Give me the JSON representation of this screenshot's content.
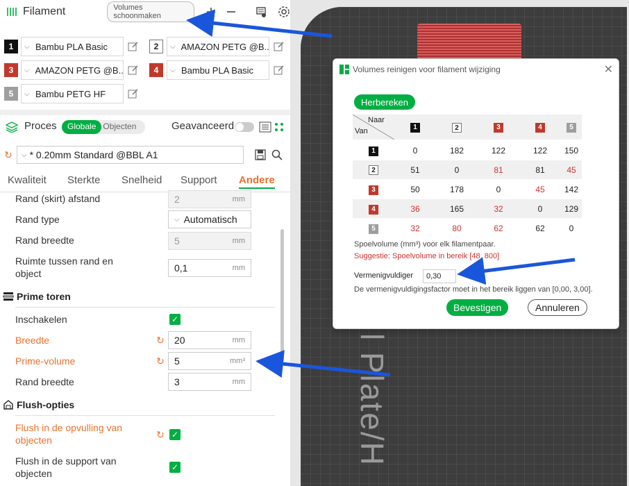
{
  "filament": {
    "title": "Filament",
    "clean_button": "Volumes schoonmaken",
    "slots": [
      {
        "num": "1",
        "name": "Bambu PLA Basic",
        "color": "#111111",
        "text_color": "#ffffff"
      },
      {
        "num": "2",
        "name": "AMAZON PETG @B...",
        "color": "#ffffff",
        "text_color": "#222222"
      },
      {
        "num": "3",
        "name": "AMAZON PETG @B...",
        "color": "#c0392b",
        "text_color": "#ffffff"
      },
      {
        "num": "4",
        "name": "Bambu PLA Basic",
        "color": "#c0392b",
        "text_color": "#ffffff"
      },
      {
        "num": "5",
        "name": "Bambu PETG HF",
        "color": "#9e9e9e",
        "text_color": "#ffffff"
      }
    ]
  },
  "process": {
    "title": "Proces",
    "seg_global": "Globale",
    "seg_objects": "Objecten",
    "advanced": "Geavanceerd",
    "preset": "* 0.20mm Standard @BBL A1"
  },
  "tabs": [
    "Kwaliteit",
    "Sterkte",
    "Snelheid",
    "Support",
    "Andere"
  ],
  "settings": {
    "skirt_distance": {
      "label": "Rand (skirt) afstand",
      "value": "2",
      "unit": "mm"
    },
    "skirt_type": {
      "label": "Rand type",
      "value": "Automatisch"
    },
    "skirt_width": {
      "label": "Rand breedte",
      "value": "5",
      "unit": "mm"
    },
    "skirt_gap": {
      "label_1": "Ruimte tussen rand en",
      "label_2": "object",
      "value": "0,1",
      "unit": "mm"
    }
  },
  "prime": {
    "title": "Prime toren",
    "enable": "Inschakelen",
    "width": {
      "label": "Breedte",
      "value": "20",
      "unit": "mm"
    },
    "volume": {
      "label": "Prime-volume",
      "value": "5",
      "unit": "mm³"
    },
    "brim": {
      "label": "Rand breedte",
      "value": "3",
      "unit": "mm"
    }
  },
  "flush": {
    "title": "Flush-opties",
    "infill_1": "Flush in de opvulling van",
    "infill_2": "objecten",
    "support_1": "Flush in de support van",
    "support_2": "objecten"
  },
  "canvas": {
    "plate_text": "l Plate/H"
  },
  "dialog": {
    "title": "Volumes reinigen voor filament wijziging",
    "recalc": "Herbereken",
    "naar": "Naar",
    "van": "Van",
    "header_chips": [
      "1",
      "2",
      "3",
      "4",
      "5"
    ],
    "rows": [
      {
        "chip": "1",
        "vals": [
          "0",
          "182",
          "122",
          "122",
          "150"
        ],
        "red": [
          false,
          false,
          false,
          false,
          false
        ]
      },
      {
        "chip": "2",
        "vals": [
          "51",
          "0",
          "81",
          "81",
          "45"
        ],
        "red": [
          false,
          false,
          true,
          false,
          true
        ]
      },
      {
        "chip": "3",
        "vals": [
          "50",
          "178",
          "0",
          "45",
          "142"
        ],
        "red": [
          false,
          false,
          false,
          true,
          false
        ]
      },
      {
        "chip": "4",
        "vals": [
          "36",
          "165",
          "32",
          "0",
          "129"
        ],
        "red": [
          true,
          false,
          true,
          false,
          false
        ]
      },
      {
        "chip": "5",
        "vals": [
          "32",
          "80",
          "62",
          "62",
          "0"
        ],
        "red": [
          true,
          true,
          true,
          false,
          false
        ]
      }
    ],
    "info": "Spoelvolume (mm³) voor elk filamentpaar.",
    "suggestion": "Suggestie: Spoelvolume in bereik [48, 800]",
    "multiplier_label": "Vermenigvuldiger",
    "multiplier_value": "0,30",
    "range_text": "De vermenigvuldigingsfactor moet in het bereik liggen van [0,00, 3,00].",
    "confirm": "Bevestigen",
    "cancel": "Annuleren"
  },
  "colors": {
    "accent": "#00ae42",
    "orange": "#e9722e",
    "red": "#d03030",
    "arrow": "#1a56db"
  }
}
